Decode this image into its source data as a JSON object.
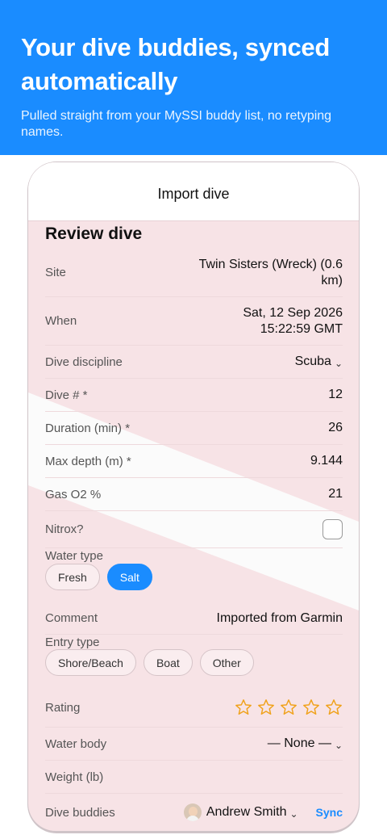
{
  "hero": {
    "title": "Your dive buddies, synced automatically",
    "subtitle": "Pulled straight from your MySSI buddy list, no retyping names."
  },
  "nav": {
    "title": "Import dive"
  },
  "section_title": "Review dive",
  "fields": {
    "site": {
      "label": "Site",
      "value_line1": "Twin Sisters (Wreck) (0.6",
      "value_line2": "km)"
    },
    "when": {
      "label": "When",
      "value_line1": "Sat, 12 Sep 2026",
      "value_line2": "15:22:59 GMT"
    },
    "discipline": {
      "label": "Dive discipline",
      "value": "Scuba"
    },
    "dive_number": {
      "label": "Dive # *",
      "value": "12"
    },
    "duration": {
      "label": "Duration (min) *",
      "value": "26"
    },
    "max_depth": {
      "label": "Max depth (m) *",
      "value": "9.144"
    },
    "gas_o2": {
      "label": "Gas O2 %",
      "value": "21"
    },
    "nitrox": {
      "label": "Nitrox?",
      "checked": false
    },
    "water_type": {
      "label": "Water type",
      "options": [
        "Fresh",
        "Salt"
      ],
      "selected": "Salt"
    },
    "comment": {
      "label": "Comment",
      "value": "Imported from Garmin"
    },
    "entry_type": {
      "label": "Entry type",
      "options": [
        "Shore/Beach",
        "Boat",
        "Other"
      ]
    },
    "rating": {
      "label": "Rating",
      "stars_filled": 0,
      "stars_total": 5
    },
    "water_body": {
      "label": "Water body",
      "value": "— None —"
    },
    "weight": {
      "label": "Weight (lb)",
      "value": ""
    },
    "dive_buddies": {
      "label": "Dive buddies",
      "buddy_name": "Andrew Smith",
      "sync_label": "Sync"
    }
  },
  "icons": {
    "dropdown": "chevron-down-icon",
    "star": "star-outline-icon",
    "avatar": "avatar-icon"
  },
  "colors": {
    "accent": "#1a8cff",
    "star": "#f0a21b",
    "screen_bg": "#f7e3e6"
  }
}
